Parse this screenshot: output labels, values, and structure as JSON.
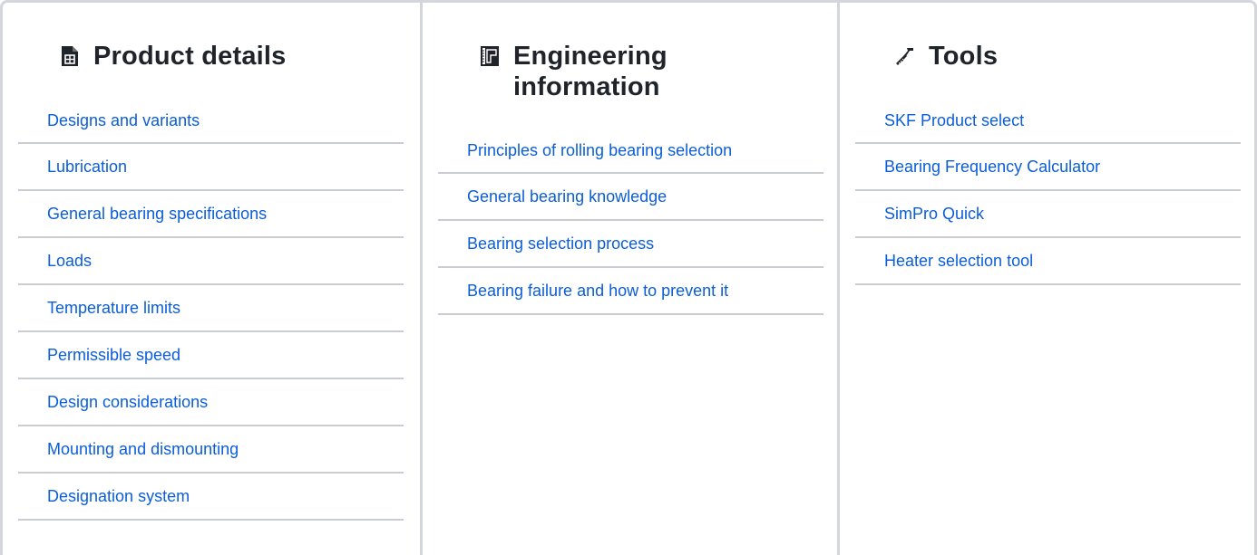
{
  "columns": {
    "product": {
      "title": "Product details",
      "icon": "document-icon",
      "links": [
        "Designs and variants",
        "Lubrication",
        "General bearing specifications",
        "Loads",
        "Temperature limits",
        "Permissible speed",
        "Design considerations",
        "Mounting and dismounting",
        "Designation system"
      ]
    },
    "engineering": {
      "title": "Engineering information",
      "icon": "blueprint-icon",
      "links": [
        "Principles of rolling bearing selection",
        "General bearing knowledge",
        "Bearing selection process",
        "Bearing failure and how to prevent it"
      ]
    },
    "tools": {
      "title": "Tools",
      "icon": "tools-icon",
      "links": [
        "SKF Product select",
        "Bearing Frequency Calculator",
        "SimPro Quick",
        "Heater selection tool"
      ]
    }
  },
  "colors": {
    "link": "#0b5ed7",
    "heading": "#1f242b",
    "divider": "#c9ccd0",
    "border": "#d3d7db"
  }
}
